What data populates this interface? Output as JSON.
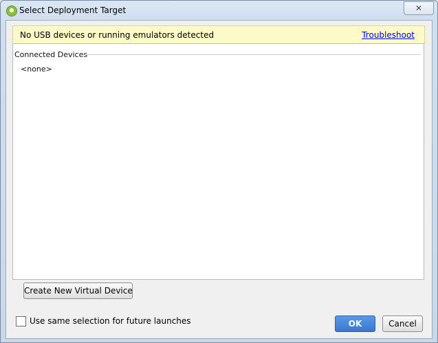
{
  "window": {
    "title": "Select Deployment Target",
    "close_glyph": "✕"
  },
  "banner": {
    "message": "No USB devices or running emulators detected",
    "link_label": "Troubleshoot",
    "background_color": "#fcfac8"
  },
  "devices": {
    "group_title": "Connected Devices",
    "items": [
      "<none>"
    ]
  },
  "actions": {
    "create_label": "Create New Virtual Device",
    "remember_label": "Use same selection for future launches",
    "remember_checked": false,
    "ok_label": "OK",
    "cancel_label": "Cancel"
  },
  "icons": {
    "app": "android-studio-icon",
    "close": "close-icon"
  },
  "colors": {
    "accent": "#3a78cf",
    "link": "#0000ee"
  }
}
